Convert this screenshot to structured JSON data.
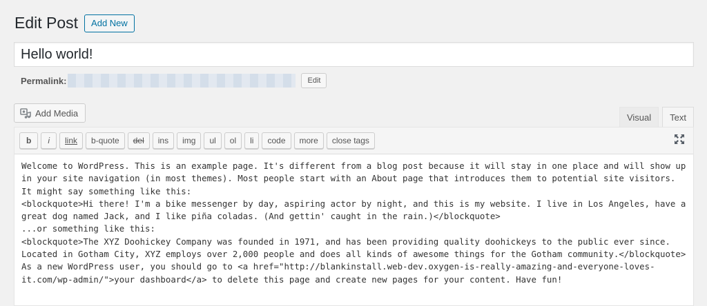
{
  "header": {
    "title": "Edit Post",
    "add_new_label": "Add New"
  },
  "post": {
    "title": "Hello world!"
  },
  "permalink": {
    "label": "Permalink:",
    "edit_label": "Edit"
  },
  "media": {
    "add_media_label": "Add Media"
  },
  "tabs": {
    "visual": "Visual",
    "text": "Text",
    "active": "Text"
  },
  "quicktags": [
    {
      "key": "b",
      "label": "b"
    },
    {
      "key": "i",
      "label": "i"
    },
    {
      "key": "link",
      "label": "link"
    },
    {
      "key": "bquote",
      "label": "b-quote"
    },
    {
      "key": "del",
      "label": "del"
    },
    {
      "key": "ins",
      "label": "ins"
    },
    {
      "key": "img",
      "label": "img"
    },
    {
      "key": "ul",
      "label": "ul"
    },
    {
      "key": "ol",
      "label": "ol"
    },
    {
      "key": "li",
      "label": "li"
    },
    {
      "key": "code",
      "label": "code"
    },
    {
      "key": "more",
      "label": "more"
    },
    {
      "key": "close",
      "label": "close tags"
    }
  ],
  "icons": {
    "add_media": "camera-music-icon",
    "fullscreen": "fullscreen-icon"
  },
  "colors": {
    "accent": "#0071a1",
    "background": "#f1f1f1",
    "text": "#23282d"
  },
  "content": {
    "body": "Welcome to WordPress. This is an example page. It's different from a blog post because it will stay in one place and will show up in your site navigation (in most themes). Most people start with an About page that introduces them to potential site visitors. It might say something like this:\n<blockquote>Hi there! I'm a bike messenger by day, aspiring actor by night, and this is my website. I live in Los Angeles, have a great dog named Jack, and I like piña coladas. (And gettin' caught in the rain.)</blockquote>\n...or something like this:\n<blockquote>The XYZ Doohickey Company was founded in 1971, and has been providing quality doohickeys to the public ever since. Located in Gotham City, XYZ employs over 2,000 people and does all kinds of awesome things for the Gotham community.</blockquote>\nAs a new WordPress user, you should go to <a href=\"http://blankinstall.web-dev.oxygen-is-really-amazing-and-everyone-loves-it.com/wp-admin/\">your dashboard</a> to delete this page and create new pages for your content. Have fun!"
  }
}
